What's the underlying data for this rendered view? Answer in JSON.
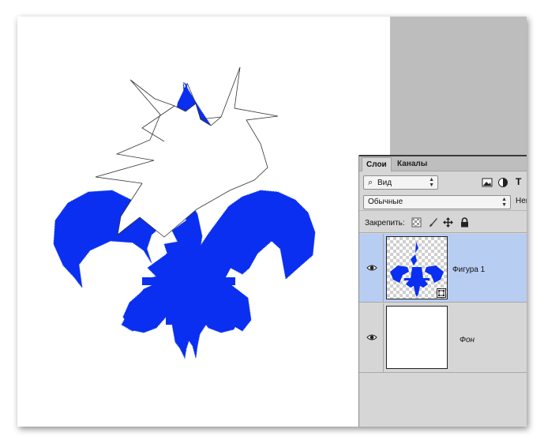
{
  "panel": {
    "tabs": [
      {
        "label": "Слои",
        "active": true
      },
      {
        "label": "Каналы",
        "active": false
      }
    ],
    "filter": {
      "value": "Вид",
      "icon": "search-icon"
    },
    "filter_icons": [
      "image-filter-icon",
      "adjustment-filter-icon",
      "type-filter-icon"
    ],
    "filter_truncated_label": "T",
    "blend_mode": "Обычные",
    "opacity_label": "Неп",
    "lock_label": "Закрепить:",
    "lock_icons": [
      "lock-transparent-pixels-icon",
      "lock-image-pixels-icon",
      "lock-position-icon",
      "lock-all-icon"
    ],
    "layers": [
      {
        "name": "Фигура 1",
        "visible": true,
        "selected": true,
        "type": "shape"
      },
      {
        "name": "Фон",
        "visible": true,
        "selected": false,
        "type": "background"
      }
    ]
  },
  "colors": {
    "shape_fill": "#0a2ff0",
    "selection_bg": "#b8cdf2",
    "panel_bg": "#d6d6d6",
    "workspace_bg": "#bdbdbd"
  }
}
